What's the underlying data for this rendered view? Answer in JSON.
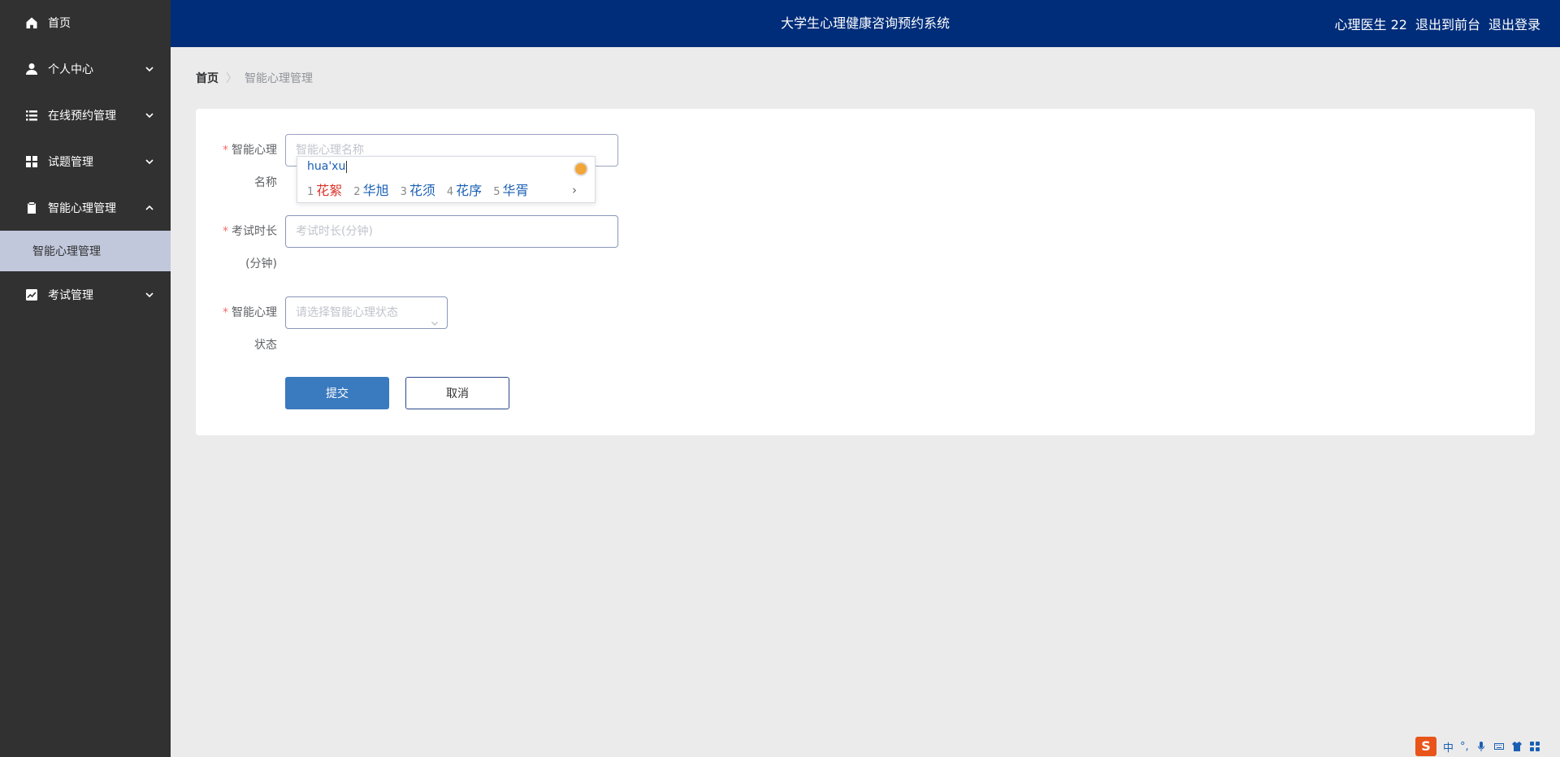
{
  "app": {
    "title": "大学生心理健康咨询预约系统"
  },
  "header": {
    "user": "心理医生 22",
    "front": "退出到前台",
    "logout": "退出登录"
  },
  "sidebar": {
    "items": [
      {
        "label": "首页",
        "icon": "home-icon"
      },
      {
        "label": "个人中心",
        "icon": "user-icon"
      },
      {
        "label": "在线预约管理",
        "icon": "list-icon"
      },
      {
        "label": "试题管理",
        "icon": "grid-icon"
      },
      {
        "label": "智能心理管理",
        "icon": "clipboard-icon"
      },
      {
        "label": "智能心理管理",
        "icon": ""
      },
      {
        "label": "考试管理",
        "icon": "chart-icon"
      }
    ]
  },
  "breadcrumb": {
    "home": "首页",
    "separator": "〉",
    "current": "智能心理管理"
  },
  "form": {
    "name": {
      "label1": "智能心理",
      "label2": "名称",
      "placeholder": "智能心理名称"
    },
    "duration": {
      "label1": "考试时长",
      "label2": "(分钟)",
      "placeholder": "考试时长(分钟)"
    },
    "status": {
      "label1": "智能心理",
      "label2": "状态",
      "placeholder": "请选择智能心理状态"
    },
    "submit": "提交",
    "cancel": "取消"
  },
  "ime": {
    "pinyin": "hua'xu",
    "candidates": [
      {
        "num": "1",
        "text": "花絮"
      },
      {
        "num": "2",
        "text": "华旭"
      },
      {
        "num": "3",
        "text": "花须"
      },
      {
        "num": "4",
        "text": "花序"
      },
      {
        "num": "5",
        "text": "华胥"
      }
    ],
    "next": "›"
  },
  "tray": {
    "sogou": "S",
    "lang": "中",
    "punct": "°,"
  },
  "colors": {
    "sidebar": "#313131",
    "header": "#002d7a",
    "primary": "#3a7abf",
    "submenu_active": "#c1c8dc",
    "required": "#f56c6c"
  }
}
